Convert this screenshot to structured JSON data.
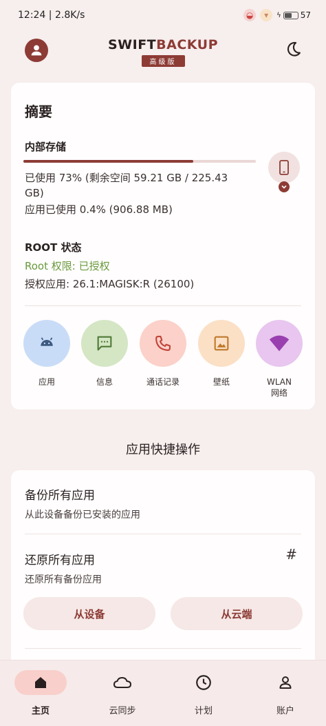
{
  "status_bar": {
    "time_speed": "12:24 | 2.8K/s",
    "battery": "57",
    "battery_level": 0.57
  },
  "header": {
    "brand_part1": "SWIFT",
    "brand_part2": "BACKUP",
    "badge": "高级版"
  },
  "summary": {
    "title": "摘要",
    "storage": {
      "label": "内部存储",
      "used_fraction": 0.73,
      "line1": "已使用 73% (剩余空间 59.21 GB / 225.43",
      "line2": "GB)",
      "apps_line": "应用已使用 0.4% (906.88 MB)"
    },
    "root": {
      "label": "ROOT 状态",
      "permission": "Root 权限: 已授权",
      "auth_app": "授权应用: 26.1:MAGISK:R (26100)"
    },
    "quick_items": [
      {
        "label": "应用",
        "icon": "android-icon",
        "color": "#c9dcf7"
      },
      {
        "label": "信息",
        "icon": "message-icon",
        "color": "#d4e6c4"
      },
      {
        "label": "通话记录",
        "icon": "phone-call-icon",
        "color": "#fbd1c9"
      },
      {
        "label": "壁纸",
        "icon": "wallpaper-icon",
        "color": "#fbe0c6"
      },
      {
        "label": "WLAN",
        "label2": "网络",
        "icon": "wifi-icon",
        "color": "#e8c6ef"
      }
    ]
  },
  "quick_actions": {
    "heading": "应用快捷操作",
    "backup_all": {
      "title": "备份所有应用",
      "subtitle": "从此设备备份已安装的应用"
    },
    "restore_all": {
      "title": "还原所有应用",
      "subtitle": "还原所有备份应用",
      "from_device": "从设备",
      "from_cloud": "从云端"
    }
  },
  "bottom_nav": {
    "items": [
      {
        "label": "主页",
        "icon": "home-icon",
        "active": true
      },
      {
        "label": "云同步",
        "icon": "cloud-icon",
        "active": false
      },
      {
        "label": "计划",
        "icon": "clock-icon",
        "active": false
      },
      {
        "label": "账户",
        "icon": "account-icon",
        "active": false
      }
    ]
  },
  "colors": {
    "accent": "#8d3b35",
    "background": "#f7eeee",
    "root_granted": "#6a9a3e"
  }
}
